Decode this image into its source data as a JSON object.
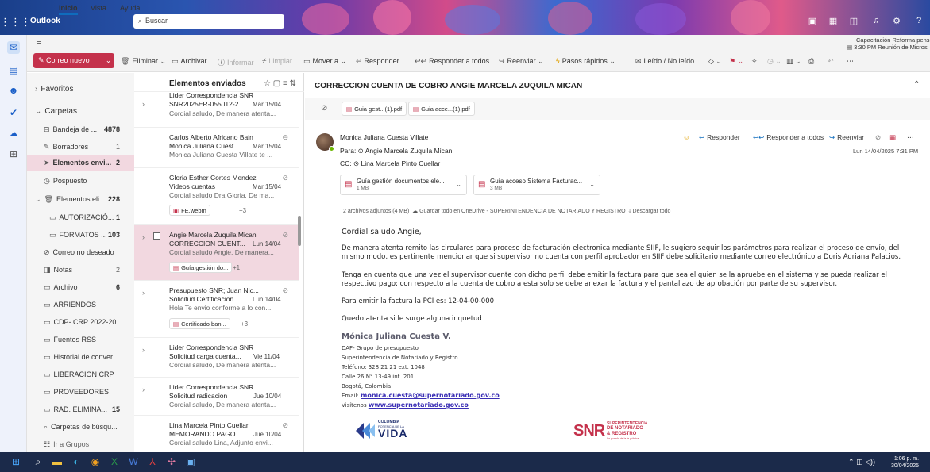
{
  "titlebar": {
    "app_name": "Outlook",
    "search_placeholder": "Buscar"
  },
  "menu": {
    "tabs": [
      "Inicio",
      "Vista",
      "Ayuda"
    ]
  },
  "reminder": {
    "title": "Capacitación Reforma pens",
    "time_line": "3:30 PM Reunión de Micros"
  },
  "ribbon": {
    "new_mail": "Correo nuevo",
    "delete": "Eliminar",
    "archive": "Archivar",
    "report": "Informar",
    "sweep": "Limpiar",
    "move_to": "Mover a",
    "reply": "Responder",
    "reply_all": "Responder a todos",
    "forward": "Reenviar",
    "quick_steps": "Pasos rápidos",
    "read_unread": "Leído / No leído"
  },
  "folders": {
    "favorites": "Favoritos",
    "folders_header": "Carpetas",
    "items": [
      {
        "label": "Bandeja de ...",
        "count": "4878"
      },
      {
        "label": "Borradores",
        "count": "1"
      },
      {
        "label": "Elementos envi...",
        "count": "2"
      },
      {
        "label": "Pospuesto",
        "count": ""
      },
      {
        "label": "Elementos eli...",
        "count": "228"
      },
      {
        "label": "AUTORIZACIÓ...",
        "count": "1"
      },
      {
        "label": "FORMATOS ...",
        "count": "103"
      },
      {
        "label": "Correo no deseado",
        "count": ""
      },
      {
        "label": "Notas",
        "count": "2"
      },
      {
        "label": "Archivo",
        "count": "6"
      },
      {
        "label": "ARRIENDOS",
        "count": ""
      },
      {
        "label": "CDP- CRP 2022-20...",
        "count": ""
      },
      {
        "label": "Fuentes RSS",
        "count": ""
      },
      {
        "label": "Historial de conver...",
        "count": ""
      },
      {
        "label": "LIBERACION CRP",
        "count": ""
      },
      {
        "label": "PROVEEDORES",
        "count": ""
      },
      {
        "label": "RAD. ELIMINA...",
        "count": "15"
      },
      {
        "label": "Carpetas de búsqu...",
        "count": ""
      },
      {
        "label": "Ir a Grupos",
        "count": ""
      }
    ]
  },
  "list": {
    "title": "Elementos enviados",
    "messages": [
      {
        "from": "Lider Correspondencia SNR",
        "subject": "SNR2025ER-055012-2",
        "date": "Mar 15/04",
        "preview": "Cordial saludo, De manera atenta..."
      },
      {
        "from": "Carlos Alberto Africano Bain",
        "subject": "Monica Juliana Cuest...",
        "date": "Mar 15/04",
        "preview": "Monica Juliana Cuesta Villate te ..."
      },
      {
        "from": "Gloria Esther Cortes Mendez",
        "subject": "Videos cuentas",
        "date": "Mar 15/04",
        "preview": "Cordial saludo Dra Gloria, De ma...",
        "attachment": "FE.webm",
        "more": "+3"
      },
      {
        "from": "Angie Marcela Zuquila Mican",
        "subject": "CORRECCION CUENT...",
        "date": "Lun 14/04",
        "preview": "Cordial saludo Angie, De manera...",
        "attachment": "Guía gestión do...",
        "more": "+1"
      },
      {
        "from": "Presupuesto SNR; Juan Nic...",
        "subject": "Solicitud Certificacion...",
        "date": "Lun 14/04",
        "preview": "Hola Te envio conforme a lo con...",
        "attachment": "Certificado ban...",
        "more": "+3"
      },
      {
        "from": "Lider Correspondencia SNR",
        "subject": "Solicitud carga cuenta...",
        "date": "Vie 11/04",
        "preview": "Cordial saludo, De manera atenta..."
      },
      {
        "from": "Lider Correspondencia SNR",
        "subject": "Solicitud radicacion",
        "date": "Jue 10/04",
        "preview": "Cordial saludo, De manera atenta..."
      },
      {
        "from": "Lina Marcela Pinto Cuellar",
        "subject": "MEMORANDO PAGO ...",
        "date": "Jue 10/04",
        "preview": "Cordial saludo Lina, Adjunto envi..."
      }
    ]
  },
  "reading": {
    "subject": "CORRECCION CUENTA DE COBRO ANGIE MARCELA ZUQUILA MICAN",
    "top_attachments": [
      "Guia gest...(1).pdf",
      "Guia acce...(1).pdf"
    ],
    "sender": "Monica Juliana Cuesta Villate",
    "to": "Para: ⊙ Angie Marcela Zuquila Mican",
    "cc": "CC: ⊙ Lina Marcela Pinto Cuellar",
    "datetime": "Lun 14/04/2025 7:31 PM",
    "actions": {
      "reply": "Responder",
      "reply_all": "Responder a todos",
      "forward": "Reenviar"
    },
    "files": [
      {
        "name": "Guía gestión documentos ele...",
        "size": "1 MB"
      },
      {
        "name": "Guía acceso Sistema Facturac...",
        "size": "3 MB"
      }
    ],
    "attach_summary": "2 archivos adjuntos (4 MB)",
    "save_onedrive": "Guardar todo en OneDrive - SUPERINTENDENCIA DE NOTARIADO Y REGISTRO",
    "download_all": "Descargar todo",
    "body": [
      "Cordial saludo Angie,",
      "De manera atenta remito las circulares para proceso de facturación electronica mediante SIIF, le sugiero seguir los parámetros para realizar el proceso de envío, del mismo modo, es pertinente mencionar que si supervisor no cuenta con perfil aprobador en SIIF debe solicitario mediante correo electrónico a Doris Adriana Palacios.",
      "Tenga en cuenta que una vez el supervisor cuente con dicho perfil debe emitir la factura para que sea el quien se la apruebe en el sistema y se pueda realizar el respectivo pago; con respecto a la cuenta de cobro a esta solo se debe anexar la factura y el pantallazo de aprobación por parte de su supervisor.",
      "Para emitir la factura la PCI es: 12-04-00-000",
      "Quedo atenta si le surge alguna inquetud"
    ],
    "signature": {
      "name": "Mónica Juliana Cuesta V.",
      "lines": [
        "DAF- Grupo de presupuesto",
        "Superintendencia de Notariado y Registro",
        "Teléfono: 328 21 21 ext. 1048",
        "Calle 26 N° 13-49 int. 201",
        "Bogotá, Colombia"
      ],
      "email_label": "Email:",
      "email": "monica.cuesta@supernotariado.gov.co",
      "web_label": "Visítenos",
      "web": "www.supernotariado.gov.co"
    },
    "logos": {
      "colombia_top": "COLOMBIA",
      "colombia_sub": "POTENCIA DE LA",
      "colombia_word": "VIDA",
      "snr_letters": "SNR",
      "snr_lines": [
        "SUPERINTENDENCIA",
        "DE NOTARIADO",
        "& REGISTRO"
      ],
      "snr_tag": "La guarda de la fe pública"
    }
  },
  "taskbar": {
    "time": "1:06 p. m.",
    "date": "30/04/2025"
  },
  "colors": {
    "accent": "#0f6cbd",
    "brand_red": "#c4314b",
    "selection": "#f2d8e0"
  }
}
